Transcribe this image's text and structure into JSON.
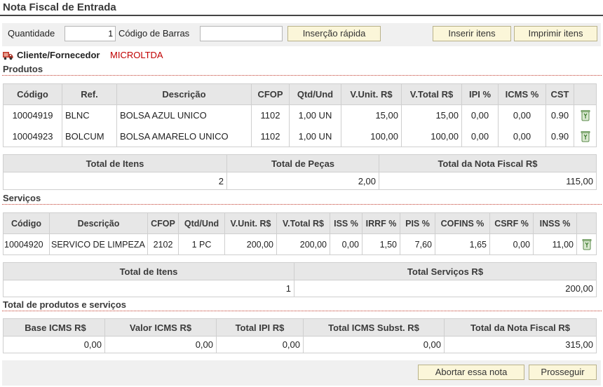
{
  "title": "Nota Fiscal de Entrada",
  "toolbar": {
    "quantity_label": "Quantidade",
    "quantity_value": "1",
    "barcode_label": "Código de Barras",
    "barcode_value": "",
    "quick_insert": "Inserção rápida",
    "insert_items": "Inserir itens",
    "print_items": "Imprimir itens"
  },
  "client": {
    "label": "Cliente/Fornecedor",
    "value": "MICROLTDA",
    "icon": "truck-icon"
  },
  "products": {
    "title": "Produtos",
    "headers": [
      "Código",
      "Ref.",
      "Descrição",
      "CFOP",
      "Qtd/Und",
      "V.Unit. R$",
      "V.Total R$",
      "IPI %",
      "ICMS %",
      "CST"
    ],
    "rows": [
      [
        "10004919",
        "BLNC",
        "BOLSA AZUL UNICO",
        "1102",
        "1,00 UN",
        "15,00",
        "15,00",
        "0,00",
        "0,00",
        "0.90"
      ],
      [
        "10004923",
        "BOLCUM",
        "BOLSA AMARELO UNICO",
        "1102",
        "1,00 UN",
        "100,00",
        "100,00",
        "0,00",
        "0,00",
        "0.90"
      ]
    ],
    "totals_headers": [
      "Total de Itens",
      "Total de Peças",
      "Total da Nota Fiscal R$"
    ],
    "totals_values": [
      "2",
      "2,00",
      "115,00"
    ]
  },
  "services": {
    "title": "Serviços",
    "headers": [
      "Código",
      "Descrição",
      "CFOP",
      "Qtd/Und",
      "V.Unit. R$",
      "V.Total R$",
      "ISS %",
      "IRRF %",
      "PIS %",
      "COFINS %",
      "CSRF %",
      "INSS %"
    ],
    "rows": [
      [
        "10004920",
        "SERVICO DE LIMPEZA",
        "2102",
        "1 PC",
        "200,00",
        "200,00",
        "0,00",
        "1,50",
        "7,60",
        "1,65",
        "0,00",
        "11,00"
      ]
    ],
    "totals_headers": [
      "Total de Itens",
      "Total Serviços R$"
    ],
    "totals_values": [
      "1",
      "200,00"
    ]
  },
  "grand": {
    "title": "Total de produtos e serviços",
    "headers": [
      "Base ICMS R$",
      "Valor ICMS R$",
      "Total IPI R$",
      "Total ICMS Subst. R$",
      "Total da Nota Fiscal R$"
    ],
    "values": [
      "0,00",
      "0,00",
      "0,00",
      "0,00",
      "315,00"
    ]
  },
  "footer": {
    "abort": "Abortar essa nota",
    "proceed": "Prosseguir"
  },
  "colors": {
    "accent_red": "#c00000",
    "button_bg": "#fbf6d9",
    "header_bg": "#e7e7e7"
  }
}
